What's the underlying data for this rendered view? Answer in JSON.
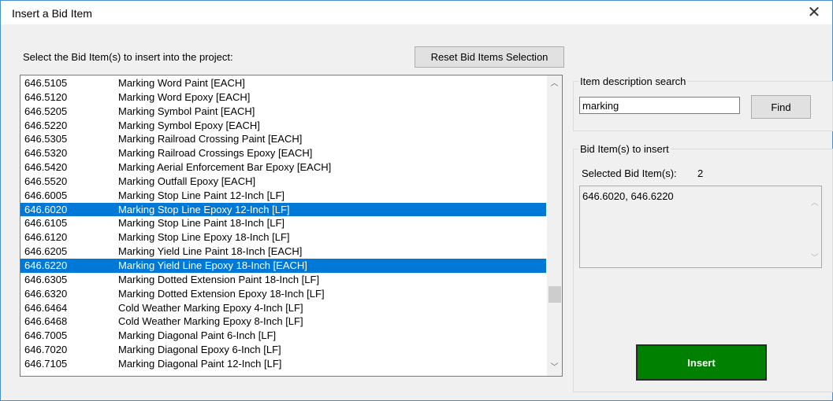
{
  "window": {
    "title": "Insert a Bid Item",
    "close_glyph": "✕"
  },
  "prompt": "Select the Bid Item(s) to insert into the project:",
  "reset_button": "Reset Bid Items Selection",
  "list": {
    "rows": [
      {
        "code": "646.5105",
        "desc": "Marking Word Paint  [EACH]",
        "selected": false
      },
      {
        "code": "646.5120",
        "desc": "Marking Word Epoxy  [EACH]",
        "selected": false
      },
      {
        "code": "646.5205",
        "desc": "Marking Symbol Paint  [EACH]",
        "selected": false
      },
      {
        "code": "646.5220",
        "desc": "Marking Symbol Epoxy  [EACH]",
        "selected": false
      },
      {
        "code": "646.5305",
        "desc": "Marking Railroad Crossing Paint  [EACH]",
        "selected": false
      },
      {
        "code": "646.5320",
        "desc": "Marking Railroad Crossings Epoxy  [EACH]",
        "selected": false
      },
      {
        "code": "646.5420",
        "desc": "Marking Aerial Enforcement Bar Epoxy  [EACH]",
        "selected": false
      },
      {
        "code": "646.5520",
        "desc": "Marking Outfall Epoxy  [EACH]",
        "selected": false
      },
      {
        "code": "646.6005",
        "desc": "Marking Stop Line Paint 12-Inch  [LF]",
        "selected": false
      },
      {
        "code": "646.6020",
        "desc": "Marking Stop Line Epoxy 12-Inch  [LF]",
        "selected": true
      },
      {
        "code": "646.6105",
        "desc": "Marking Stop Line Paint 18-Inch  [LF]",
        "selected": false
      },
      {
        "code": "646.6120",
        "desc": "Marking Stop Line Epoxy 18-Inch  [LF]",
        "selected": false
      },
      {
        "code": "646.6205",
        "desc": "Marking Yield Line Paint 18-Inch  [EACH]",
        "selected": false
      },
      {
        "code": "646.6220",
        "desc": "Marking Yield Line Epoxy 18-Inch  [EACH]",
        "selected": true
      },
      {
        "code": "646.6305",
        "desc": "Marking Dotted Extension Paint 18-Inch  [LF]",
        "selected": false
      },
      {
        "code": "646.6320",
        "desc": "Marking Dotted Extension Epoxy 18-Inch  [LF]",
        "selected": false
      },
      {
        "code": "646.6464",
        "desc": "Cold Weather Marking Epoxy 4-Inch  [LF]",
        "selected": false
      },
      {
        "code": "646.6468",
        "desc": "Cold Weather Marking Epoxy 8-Inch  [LF]",
        "selected": false
      },
      {
        "code": "646.7005",
        "desc": "Marking Diagonal Paint 6-Inch  [LF]",
        "selected": false
      },
      {
        "code": "646.7020",
        "desc": "Marking Diagonal Epoxy 6-Inch  [LF]",
        "selected": false
      },
      {
        "code": "646.7105",
        "desc": "Marking Diagonal Paint 12-Inch  [LF]",
        "selected": false
      }
    ],
    "scroll_up_glyph": "︿",
    "scroll_down_glyph": "﹀"
  },
  "search": {
    "group_title": "Item description search",
    "value": "marking",
    "find_label": "Find"
  },
  "insert_group": {
    "title": "Bid Item(s) to insert",
    "selected_label": "Selected Bid Item(s):",
    "selected_count": "2",
    "selected_text": "646.6020, 646.6220",
    "scroll_up_glyph": "︿",
    "scroll_down_glyph": "﹀",
    "insert_label": "Insert"
  },
  "colors": {
    "selection": "#0078d7",
    "insert_button": "#008000",
    "window_border": "#4a90c8"
  }
}
